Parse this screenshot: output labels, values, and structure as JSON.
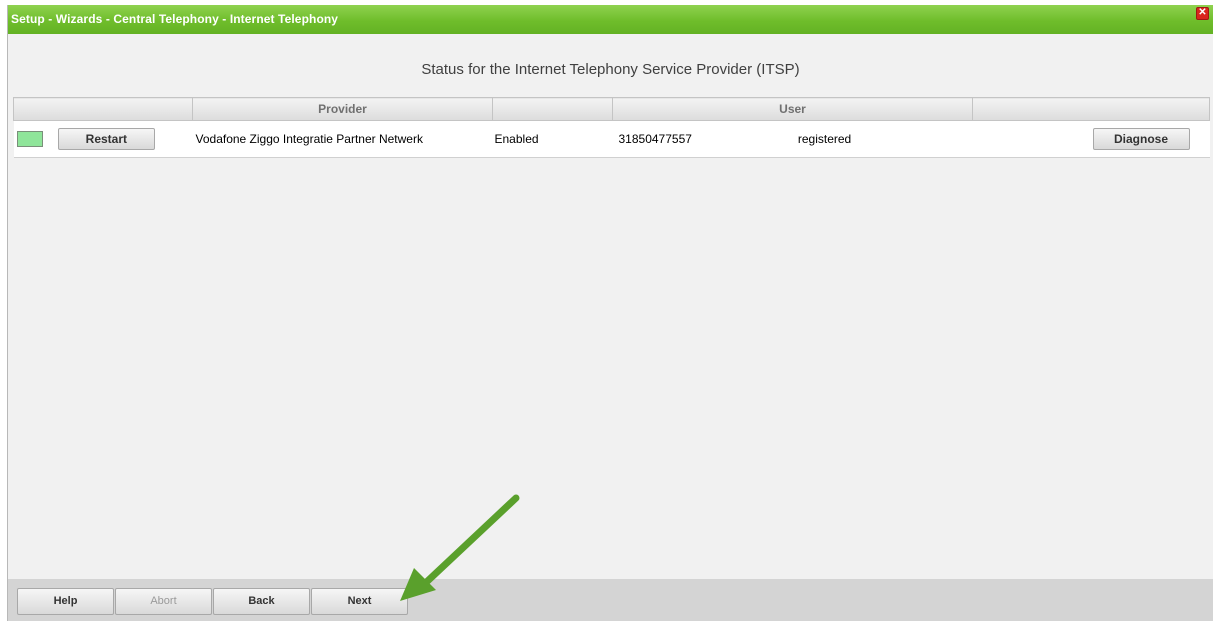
{
  "window": {
    "title": "Setup - Wizards - Central Telephony - Internet Telephony",
    "close_symbol": "✕"
  },
  "heading": "Status for the Internet Telephony Service Provider (ITSP)",
  "table": {
    "columns": [
      "",
      "Provider",
      "",
      "User",
      ""
    ],
    "rows": [
      {
        "status_color": "#8fe59a",
        "restart_label": "Restart",
        "provider": "Vodafone Ziggo Integratie Partner Netwerk",
        "state": "Enabled",
        "user": "31850477557",
        "registration": "registered",
        "diagnose_label": "Diagnose"
      }
    ]
  },
  "footer": {
    "help": "Help",
    "abort": "Abort",
    "back": "Back",
    "next": "Next"
  },
  "annotation": {
    "arrow_color": "#5aa02c",
    "points_to": "Next"
  }
}
